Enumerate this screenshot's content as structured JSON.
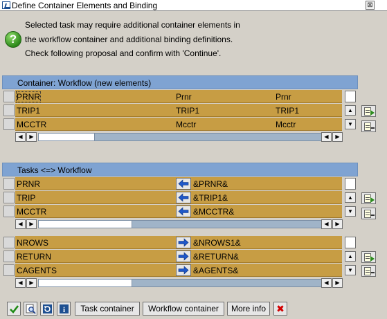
{
  "window": {
    "title": "Define Container Elements and Binding",
    "close_glyph": "⊠"
  },
  "message": {
    "icon": "question-icon",
    "icon_glyph": "?",
    "lines": [
      "Selected task may require additional container elements in",
      "the workflow container and additional binding definitions.",
      "Check following proposal and confirm with 'Continue'."
    ]
  },
  "container_table": {
    "title": "Container: Workflow (new elements)",
    "rows": [
      {
        "element": "PRNR",
        "name": "Prnr",
        "description": "Prnr"
      },
      {
        "element": "TRIP1",
        "name": "TRIP1",
        "description": "TRIP1"
      },
      {
        "element": "MCCTR",
        "name": "Mcctr",
        "description": "Mcctr"
      }
    ]
  },
  "binding_table": {
    "title": "Tasks <=> Workflow",
    "rows": [
      {
        "task_element": "PRNR",
        "direction": "left",
        "expression": "&PRNR&"
      },
      {
        "task_element": "TRIP",
        "direction": "left",
        "expression": "&TRIP1&"
      },
      {
        "task_element": "MCCTR",
        "direction": "left",
        "expression": "&MCCTR&"
      }
    ]
  },
  "binding_table_2": {
    "rows": [
      {
        "task_element": "NROWS",
        "direction": "right",
        "expression": "&NROWS1&"
      },
      {
        "task_element": "RETURN",
        "direction": "right",
        "expression": "&RETURN&"
      },
      {
        "task_element": "CAGENTS",
        "direction": "right",
        "expression": "&AGENTS&"
      }
    ]
  },
  "scroll": {
    "left_glyph": "◀",
    "right_glyph": "▶",
    "up_glyph": "▲",
    "down_glyph": "▼"
  },
  "footer": {
    "icons": [
      "continue-check-icon",
      "find-icon",
      "refresh-icon",
      "info-icon"
    ],
    "info_glyph": "i",
    "buttons": {
      "task_container": "Task container",
      "workflow_container": "Workflow container",
      "more_info": "More info"
    },
    "cancel_glyph": "✖"
  },
  "colors": {
    "header_blue": "#7fa3d2",
    "row_gold": "#c79d44",
    "panel_gray": "#d4d0c8"
  }
}
